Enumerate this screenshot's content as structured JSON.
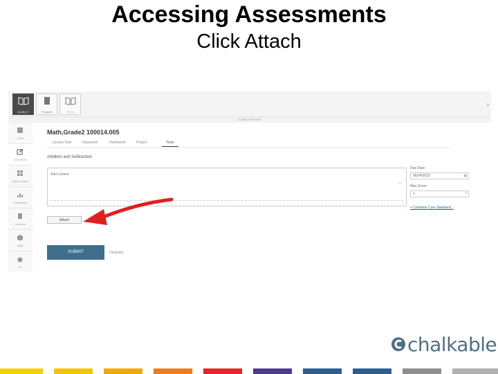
{
  "slide": {
    "title": "Accessing Assessments",
    "subtitle": "Click Attach"
  },
  "app": {
    "top_buttons": [
      {
        "label": "Quality P.",
        "icon": "open-book-icon",
        "active": true
      },
      {
        "label": "Program",
        "icon": "document-icon",
        "active": false
      },
      {
        "label": "Tr. Cl.",
        "icon": "open-book-icon",
        "active": false
      }
    ],
    "course_bar": "COMPUTER ONE",
    "side_nav": [
      {
        "label": "Feed",
        "icon": "feed-icon"
      },
      {
        "label": "Give Work",
        "icon": "edit-icon",
        "active": true
      },
      {
        "label": "Class Groups",
        "icon": "grid-icon"
      },
      {
        "label": "Gradebook",
        "icon": "chart-icon"
      },
      {
        "label": "Lessons",
        "icon": "clipboard-icon"
      },
      {
        "label": "Apps",
        "icon": "box-icon"
      },
      {
        "label": "Kit",
        "icon": "apple-icon"
      }
    ],
    "class_title": "Math,Grade2 100014.005",
    "tabs": [
      "Lesson Plan",
      "Classwork",
      "Homework",
      "Project",
      "Tests"
    ],
    "active_tab": 4,
    "assessment_title": "Addition and Subtraction",
    "content_placeholder": "Add content",
    "attach_label": "Attach",
    "submit_label": "SUBMIT",
    "unsaved_note": "Unsaved",
    "due_date_label": "Due Date",
    "due_date_value": "06/24/2015",
    "max_score_label": "Max Score",
    "max_score_value": "1",
    "standards_link": "+ Common Core Standard..."
  },
  "logo_text": "chalkable",
  "colors": {
    "submit": "#3d6e8c",
    "arrow": "#e02020",
    "logo": "#4f6f83",
    "footer_strip": [
      "#f5d000",
      "#f2c500",
      "#f2a900",
      "#ef7d1f",
      "#e3262b",
      "#4a3b8f",
      "#2e5f8c",
      "#9a9a9a"
    ]
  }
}
